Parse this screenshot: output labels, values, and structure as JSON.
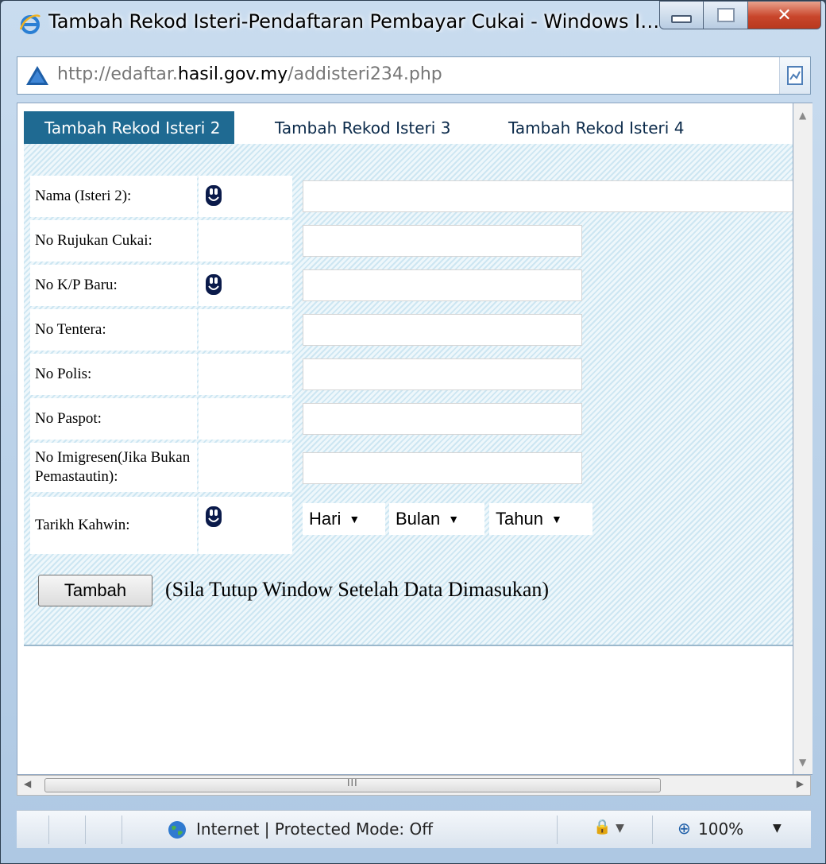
{
  "window": {
    "title": "Tambah Rekod Isteri-Pendaftaran Pembayar Cukai - Windows Interne..."
  },
  "address": {
    "url_prefix": "http://edaftar.",
    "url_host": "hasil.gov.my",
    "url_path": "/addisteri234.php"
  },
  "tabs": [
    {
      "label": "Tambah Rekod Isteri 2",
      "active": true
    },
    {
      "label": "Tambah Rekod Isteri 3",
      "active": false
    },
    {
      "label": "Tambah Rekod Isteri 4",
      "active": false
    }
  ],
  "form": {
    "fields": [
      {
        "label": "Nama (Isteri 2):",
        "required": true,
        "value": ""
      },
      {
        "label": "No Rujukan Cukai:",
        "required": false,
        "value": ""
      },
      {
        "label": "No K/P Baru:",
        "required": true,
        "value": ""
      },
      {
        "label": "No Tentera:",
        "required": false,
        "value": ""
      },
      {
        "label": "No Polis:",
        "required": false,
        "value": ""
      },
      {
        "label": "No Paspot:",
        "required": false,
        "value": ""
      },
      {
        "label": "No Imigresen(Jika Bukan Pemastautin):",
        "required": false,
        "value": ""
      }
    ],
    "date": {
      "label": "Tarikh Kahwin:",
      "required": true,
      "day": "Hari",
      "month": "Bulan",
      "year": "Tahun"
    },
    "submit_label": "Tambah",
    "note": "(Sila Tutup Window Setelah Data Dimasukan)"
  },
  "status": {
    "zone_text": "Internet | Protected Mode: Off",
    "zoom": "100%"
  },
  "colors": {
    "tab_active": "#1f6a92",
    "form_bg": "#e3f1f8"
  }
}
